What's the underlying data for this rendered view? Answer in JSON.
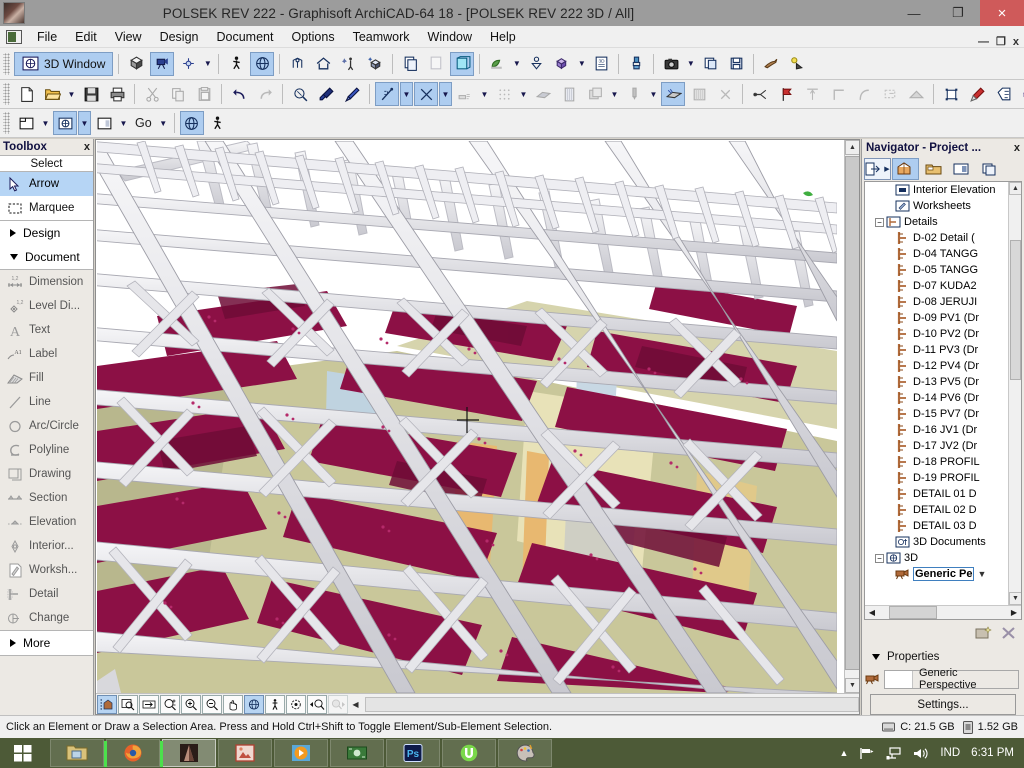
{
  "window": {
    "title": "POLSEK REV 222 - Graphisoft ArchiCAD-64 18 - [POLSEK REV 222 3D / All]",
    "minimize": "—",
    "maximize": "❐",
    "close": "×",
    "mdi_minimize": "—",
    "mdi_restore": "❐",
    "mdi_close": "x"
  },
  "menubar": {
    "items": [
      {
        "label": "File"
      },
      {
        "label": "Edit"
      },
      {
        "label": "View"
      },
      {
        "label": "Design"
      },
      {
        "label": "Document"
      },
      {
        "label": "Options"
      },
      {
        "label": "Teamwork"
      },
      {
        "label": "Window"
      },
      {
        "label": "Help"
      }
    ]
  },
  "toolbar_3d": {
    "window_button": "3D Window",
    "go_label": "Go"
  },
  "toolbox": {
    "title": "Toolbox",
    "close": "x",
    "header": "Select",
    "items": [
      {
        "label": "Arrow",
        "icon": "arrow-cursor-icon",
        "selected": true,
        "enabled": true
      },
      {
        "label": "Marquee",
        "icon": "marquee-icon",
        "selected": false,
        "enabled": true
      }
    ],
    "groups": [
      {
        "label": "Design",
        "state": "collapsed"
      },
      {
        "label": "Document",
        "state": "expanded"
      }
    ],
    "document_items": [
      {
        "label": "Dimension",
        "icon": "dimension-icon"
      },
      {
        "label": "Level Di...",
        "icon": "level-dimension-icon"
      },
      {
        "label": "Text",
        "icon": "text-icon"
      },
      {
        "label": "Label",
        "icon": "label-icon"
      },
      {
        "label": "Fill",
        "icon": "fill-icon"
      },
      {
        "label": "Line",
        "icon": "line-icon"
      },
      {
        "label": "Arc/Circle",
        "icon": "arc-circle-icon"
      },
      {
        "label": "Polyline",
        "icon": "polyline-icon"
      },
      {
        "label": "Drawing",
        "icon": "drawing-icon"
      },
      {
        "label": "Section",
        "icon": "section-icon"
      },
      {
        "label": "Elevation",
        "icon": "elevation-icon"
      },
      {
        "label": "Interior...",
        "icon": "interior-elevation-icon"
      },
      {
        "label": "Worksh...",
        "icon": "worksheet-icon"
      },
      {
        "label": "Detail",
        "icon": "detail-icon"
      },
      {
        "label": "Change",
        "icon": "change-icon"
      }
    ],
    "more_label": "More"
  },
  "navigator": {
    "title": "Navigator - Project ...",
    "close": "x",
    "tree": [
      {
        "label": "Interior Elevation",
        "icon": "interior-elevation-icon",
        "indent": 1,
        "expander": "none",
        "selected": false
      },
      {
        "label": "Worksheets",
        "icon": "worksheet-icon",
        "indent": 1,
        "expander": "none",
        "selected": false
      },
      {
        "label": "Details",
        "icon": "details-folder-icon",
        "indent": 1,
        "expander": "minus",
        "selected": false
      },
      {
        "label": "D-02 Detail (",
        "icon": "detail-leaf-icon",
        "indent": 2,
        "expander": "none",
        "selected": false
      },
      {
        "label": "D-04 TANGG",
        "icon": "detail-leaf-icon",
        "indent": 2,
        "expander": "none",
        "selected": false
      },
      {
        "label": "D-05 TANGG",
        "icon": "detail-leaf-icon",
        "indent": 2,
        "expander": "none",
        "selected": false
      },
      {
        "label": "D-07 KUDA2",
        "icon": "detail-leaf-icon",
        "indent": 2,
        "expander": "none",
        "selected": false
      },
      {
        "label": "D-08 JERUJI",
        "icon": "detail-leaf-icon",
        "indent": 2,
        "expander": "none",
        "selected": false
      },
      {
        "label": "D-09 PV1 (Dr",
        "icon": "detail-leaf-icon",
        "indent": 2,
        "expander": "none",
        "selected": false
      },
      {
        "label": "D-10 PV2 (Dr",
        "icon": "detail-leaf-icon",
        "indent": 2,
        "expander": "none",
        "selected": false
      },
      {
        "label": "D-11 PV3 (Dr",
        "icon": "detail-leaf-icon",
        "indent": 2,
        "expander": "none",
        "selected": false
      },
      {
        "label": "D-12 PV4 (Dr",
        "icon": "detail-leaf-icon",
        "indent": 2,
        "expander": "none",
        "selected": false
      },
      {
        "label": "D-13 PV5 (Dr",
        "icon": "detail-leaf-icon",
        "indent": 2,
        "expander": "none",
        "selected": false
      },
      {
        "label": "D-14 PV6 (Dr",
        "icon": "detail-leaf-icon",
        "indent": 2,
        "expander": "none",
        "selected": false
      },
      {
        "label": "D-15 PV7 (Dr",
        "icon": "detail-leaf-icon",
        "indent": 2,
        "expander": "none",
        "selected": false
      },
      {
        "label": "D-16 JV1 (Dr",
        "icon": "detail-leaf-icon",
        "indent": 2,
        "expander": "none",
        "selected": false
      },
      {
        "label": "D-17 JV2 (Dr",
        "icon": "detail-leaf-icon",
        "indent": 2,
        "expander": "none",
        "selected": false
      },
      {
        "label": "D-18 PROFIL",
        "icon": "detail-leaf-icon",
        "indent": 2,
        "expander": "none",
        "selected": false
      },
      {
        "label": "D-19 PROFIL",
        "icon": "detail-leaf-icon",
        "indent": 2,
        "expander": "none",
        "selected": false
      },
      {
        "label": "DETAIL 01 D",
        "icon": "detail-leaf-icon",
        "indent": 2,
        "expander": "none",
        "selected": false
      },
      {
        "label": "DETAIL 02 D",
        "icon": "detail-leaf-icon",
        "indent": 2,
        "expander": "none",
        "selected": false
      },
      {
        "label": "DETAIL 03 D",
        "icon": "detail-leaf-icon",
        "indent": 2,
        "expander": "none",
        "selected": false
      },
      {
        "label": "3D Documents",
        "icon": "3d-document-icon",
        "indent": 1,
        "expander": "none",
        "selected": false
      },
      {
        "label": "3D",
        "icon": "3d-folder-icon",
        "indent": 1,
        "expander": "minus",
        "selected": false
      },
      {
        "label": "Generic Pe",
        "icon": "camera-icon",
        "indent": 2,
        "expander": "none",
        "selected": true
      }
    ],
    "properties": {
      "header": "Properties",
      "value": "Generic Perspective",
      "settings_button": "Settings..."
    }
  },
  "statusbar": {
    "message": "Click an Element or Draw a Selection Area. Press and Hold Ctrl+Shift to Toggle Element/Sub-Element Selection.",
    "disk": "C: 21.5 GB",
    "memory": "1.52 GB"
  },
  "taskbar": {
    "start": "start-icon",
    "tasks": [
      {
        "name": "file-explorer",
        "icon": "folder-icon",
        "active": false,
        "running": false
      },
      {
        "name": "firefox",
        "icon": "firefox-icon",
        "active": false,
        "running": true
      },
      {
        "name": "archicad",
        "icon": "archicad-icon",
        "active": true,
        "running": true
      },
      {
        "name": "image-viewer",
        "icon": "picture-icon",
        "active": false,
        "running": false
      },
      {
        "name": "media-player",
        "icon": "play-icon",
        "active": false,
        "running": false
      },
      {
        "name": "money-app",
        "icon": "banknote-icon",
        "active": false,
        "running": false
      },
      {
        "name": "photoshop",
        "icon": "photoshop-icon",
        "active": false,
        "running": false
      },
      {
        "name": "utorrent",
        "icon": "utorrent-icon",
        "active": false,
        "running": false
      },
      {
        "name": "paint-app",
        "icon": "palette-icon",
        "active": false,
        "running": false
      }
    ],
    "tray": {
      "show_hidden": "▲",
      "network": "network-icon",
      "volume": "volume-icon",
      "language": "IND",
      "clock": "6:31 PM"
    }
  },
  "colors": {
    "title_bar": "#9c9c9c",
    "close_red": "#cf5a5a",
    "toolbar_bg": "#f0f0f0",
    "selection_blue": "#aecdf0",
    "taskbar_green": "#4d5a37",
    "truss_white": "#e8e8ea",
    "roof_maroon": "#8c1045",
    "wall_olive": "#c9c79a"
  }
}
